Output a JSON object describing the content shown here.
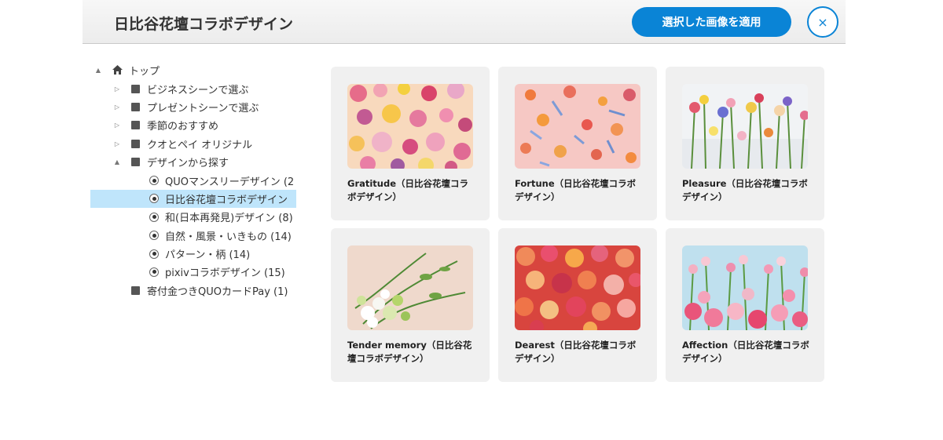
{
  "header": {
    "title": "日比谷花壇コラボデザイン",
    "apply_button": "選択した画像を適用",
    "close_button": "×"
  },
  "tree": {
    "root": "トップ",
    "items": [
      {
        "label": "ビジネスシーンで選ぶ"
      },
      {
        "label": "プレゼントシーンで選ぶ"
      },
      {
        "label": "季節のおすすめ"
      },
      {
        "label": "クオとペイ オリジナル"
      },
      {
        "label": "デザインから探す"
      },
      {
        "label": "QUOマンスリーデザイン (2"
      },
      {
        "label": "日比谷花壇コラボデザイン"
      },
      {
        "label": "和(日本再発見)デザイン (8)"
      },
      {
        "label": "自然・風景・いきもの (14)"
      },
      {
        "label": "パターン・柄 (14)"
      },
      {
        "label": "pixivコラボデザイン (15)"
      },
      {
        "label": "寄付金つきQUOカードPay (1)"
      }
    ]
  },
  "gallery": {
    "cards": [
      {
        "caption": "Gratitude（日比谷花壇コラボデザイン）",
        "image": "pink-yellow-dahlias"
      },
      {
        "caption": "Fortune（日比谷花壇コラボデザイン）",
        "image": "orange-blue-scattered-flowers"
      },
      {
        "caption": "Pleasure（日比谷花壇コラボデザイン）",
        "image": "wildflower-meadow"
      },
      {
        "caption": "Tender memory（日比谷花壇コラボデザイン）",
        "image": "white-green-bouquet"
      },
      {
        "caption": "Dearest（日比谷花壇コラボデザイン）",
        "image": "red-orange-anthurium"
      },
      {
        "caption": "Affection（日比谷花壇コラボデザイン）",
        "image": "pink-roses-blue-sky"
      }
    ]
  },
  "colors": {
    "accent": "#0a84d6",
    "selected_row": "#bfe5fb",
    "card_bg": "#f0f0f0"
  }
}
